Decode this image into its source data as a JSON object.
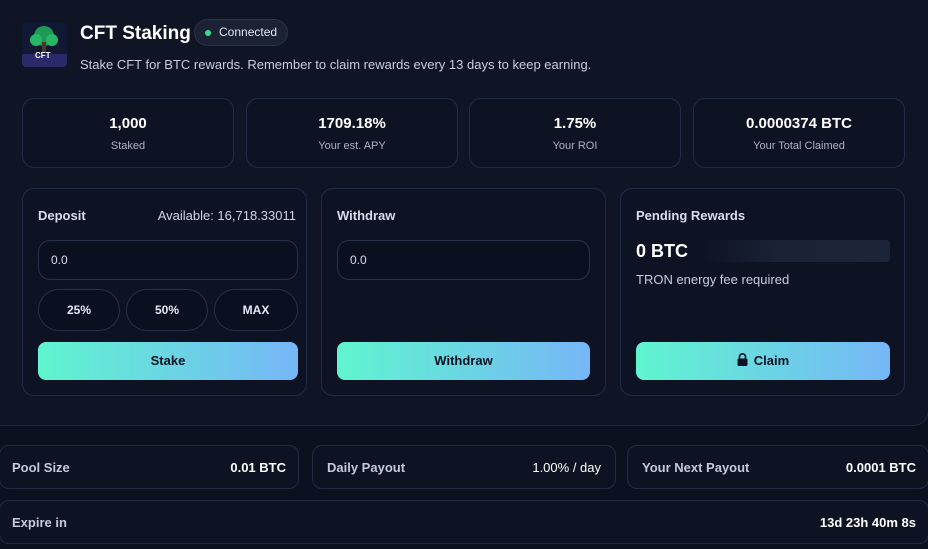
{
  "header": {
    "title": "CFT Staking",
    "status": "Connected",
    "subtitle": "Stake CFT for BTC rewards. Remember to claim rewards every 13 days to keep earning.",
    "logo_text": "CFT"
  },
  "stats": [
    {
      "value": "1,000",
      "label": "Staked"
    },
    {
      "value": "1709.18%",
      "label": "Your est. APY"
    },
    {
      "value": "1.75%",
      "label": "Your ROI"
    },
    {
      "value": "0.0000374 BTC",
      "label": "Your Total Claimed"
    }
  ],
  "deposit": {
    "title": "Deposit",
    "available": "Available: 16,718.33011",
    "input_value": "0.0",
    "pct_25": "25%",
    "pct_50": "50%",
    "pct_max": "MAX",
    "button": "Stake"
  },
  "withdraw": {
    "title": "Withdraw",
    "input_value": "0.0",
    "button": "Withdraw"
  },
  "rewards": {
    "title": "Pending Rewards",
    "amount": "0 BTC",
    "note": "TRON energy fee required",
    "button": "Claim"
  },
  "pool": {
    "pool_size_label": "Pool Size",
    "pool_size_value": "0.01 BTC",
    "daily_payout_label": "Daily Payout",
    "daily_payout_value": "1.00% / day",
    "next_payout_label": "Your Next Payout",
    "next_payout_value": "0.0001 BTC",
    "expire_label": "Expire in",
    "expire_value": "13d 23h 40m 8s"
  },
  "colors": {
    "accent_start": "#5ff5cf",
    "accent_end": "#76b6f7",
    "status_dot": "#34e08a",
    "background": "#0c1120"
  }
}
